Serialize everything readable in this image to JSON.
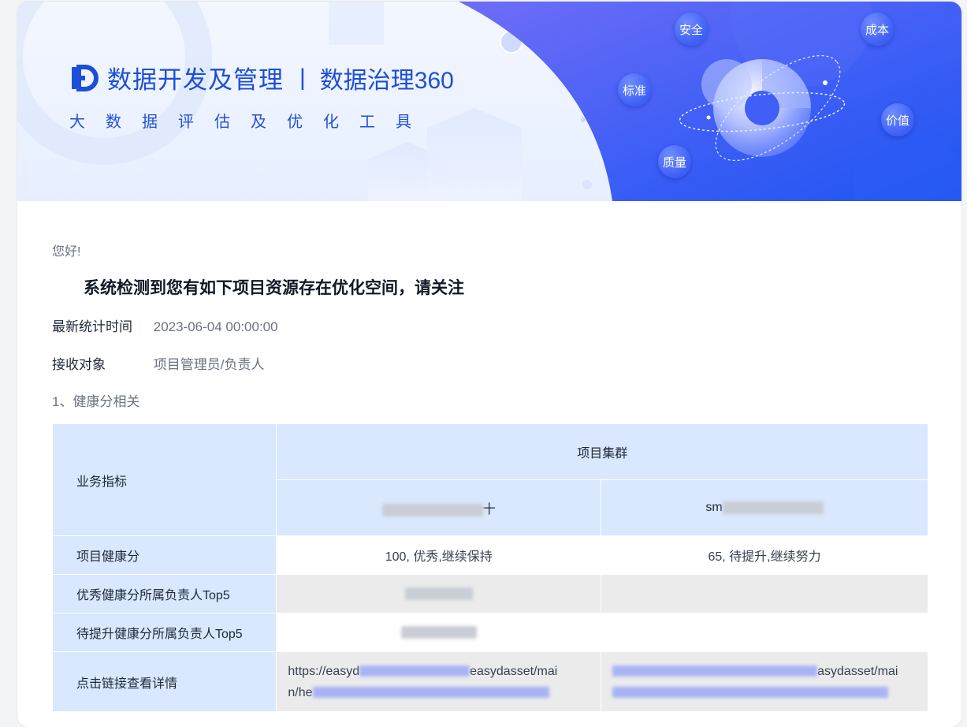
{
  "banner": {
    "brand_title": "数据开发及管理",
    "brand_sep": "|",
    "brand_sub": "数据治理360",
    "tagline": "大数据评估及优化工具",
    "bubbles": {
      "safety": "安全",
      "cost": "成本",
      "standard": "标准",
      "value": "价值",
      "quality": "质量"
    }
  },
  "greeting": "您好!",
  "headline": "系统检测到您有如下项目资源存在优化空间，请关注",
  "meta": {
    "stat_time_label": "最新统计时间",
    "stat_time_value": "2023-06-04 00:00:00",
    "recipient_label": "接收对象",
    "recipient_value": "项目管理员/负责人"
  },
  "section_title": "1、健康分相关",
  "table": {
    "metric_header": "业务指标",
    "group_header": "项目集群",
    "col1_visible": "十",
    "col2_visible_prefix": "sm",
    "rows": {
      "health_label": "项目健康分",
      "health_c1": "100, 优秀,继续保持",
      "health_c2": "65, 待提升,继续努力",
      "top_excellent_label": "优秀健康分所属负责人Top5",
      "top_improve_label": "待提升健康分所属负责人Top5",
      "link_label": "点击链接查看详情",
      "link1_line1_a": "https://easyd",
      "link1_line1_b": "easydasset/mai",
      "link1_line2_a": "n/he",
      "link2_line1_b": "asydasset/mai"
    }
  },
  "colors": {
    "brand_blue": "#1d4ed8",
    "header_bg": "#d9e7ff",
    "banner_blue": "#2f55f5"
  }
}
